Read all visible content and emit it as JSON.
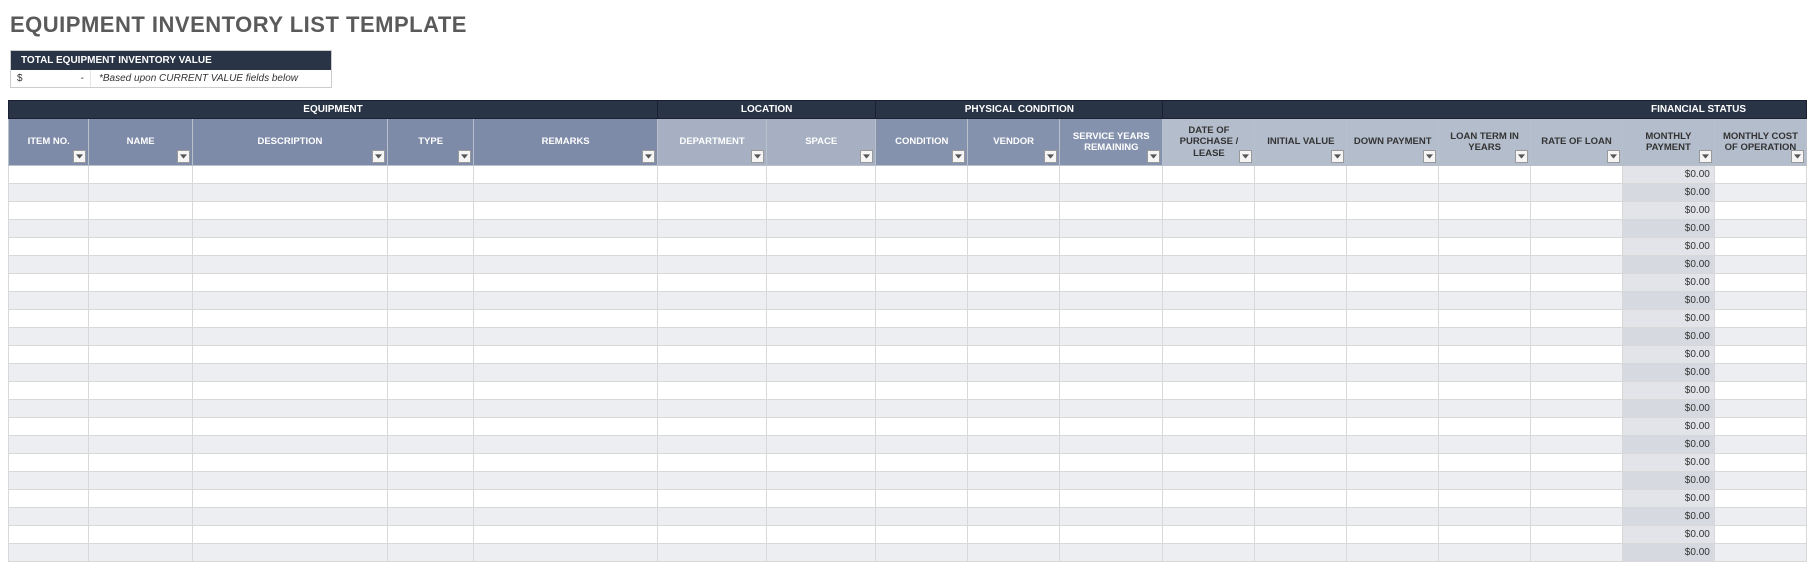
{
  "title": "EQUIPMENT INVENTORY LIST TEMPLATE",
  "totalBox": {
    "header": "TOTAL EQUIPMENT INVENTORY VALUE",
    "currency": "$",
    "dash": "-",
    "note": "*Based upon CURRENT VALUE fields below"
  },
  "groups": {
    "equipment": "EQUIPMENT",
    "location": "LOCATION",
    "physicalCondition": "PHYSICAL CONDITION",
    "financialStatus": "FINANCIAL STATUS"
  },
  "columns": {
    "itemNo": "ITEM NO.",
    "name": "NAME",
    "description": "DESCRIPTION",
    "type": "TYPE",
    "remarks": "REMARKS",
    "department": "DEPARTMENT",
    "space": "SPACE",
    "condition": "CONDITION",
    "vendor": "VENDOR",
    "serviceYears": "SERVICE YEARS REMAINING",
    "datePurchase": "DATE OF PURCHASE / LEASE",
    "initialValue": "INITIAL VALUE",
    "downPayment": "DOWN PAYMENT",
    "loanTerm": "LOAN TERM IN YEARS",
    "rateOfLoan": "RATE OF LOAN",
    "monthlyPayment": "MONTHLY PAYMENT",
    "monthlyCost": "MONTHLY COST OF OPERATION"
  },
  "rows": [
    {
      "monthlyPayment": "$0.00"
    },
    {
      "monthlyPayment": "$0.00"
    },
    {
      "monthlyPayment": "$0.00"
    },
    {
      "monthlyPayment": "$0.00"
    },
    {
      "monthlyPayment": "$0.00"
    },
    {
      "monthlyPayment": "$0.00"
    },
    {
      "monthlyPayment": "$0.00"
    },
    {
      "monthlyPayment": "$0.00"
    },
    {
      "monthlyPayment": "$0.00"
    },
    {
      "monthlyPayment": "$0.00"
    },
    {
      "monthlyPayment": "$0.00"
    },
    {
      "monthlyPayment": "$0.00"
    },
    {
      "monthlyPayment": "$0.00"
    },
    {
      "monthlyPayment": "$0.00"
    },
    {
      "monthlyPayment": "$0.00"
    },
    {
      "monthlyPayment": "$0.00"
    },
    {
      "monthlyPayment": "$0.00"
    },
    {
      "monthlyPayment": "$0.00"
    },
    {
      "monthlyPayment": "$0.00"
    },
    {
      "monthlyPayment": "$0.00"
    },
    {
      "monthlyPayment": "$0.00"
    },
    {
      "monthlyPayment": "$0.00"
    }
  ]
}
